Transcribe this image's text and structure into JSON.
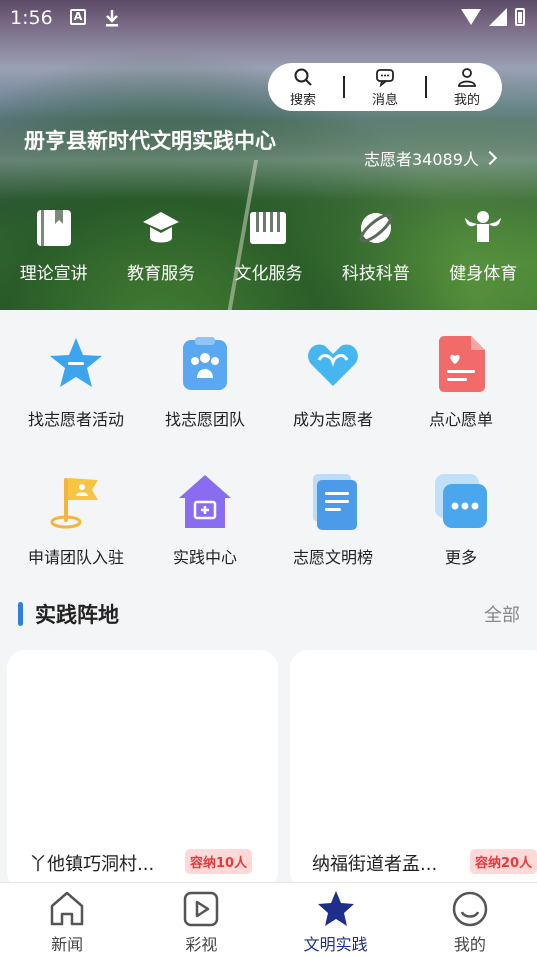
{
  "status_bar": {
    "time": "1:56",
    "a_icon": "A"
  },
  "toolbox": {
    "search": "搜索",
    "messages": "消息",
    "mine": "我的"
  },
  "center": {
    "title": "册亨县新时代文明实践中心",
    "volunteer_count": "志愿者34089人"
  },
  "hero_categories": [
    {
      "label": "理论宣讲",
      "icon": "book-icon"
    },
    {
      "label": "教育服务",
      "icon": "graduation-cap-icon"
    },
    {
      "label": "文化服务",
      "icon": "piano-icon"
    },
    {
      "label": "科技科普",
      "icon": "planet-icon"
    },
    {
      "label": "健身体育",
      "icon": "muscle-icon"
    }
  ],
  "services": [
    {
      "label": "找志愿者活动",
      "icon": "star-icon"
    },
    {
      "label": "找志愿团队",
      "icon": "team-clipboard-icon"
    },
    {
      "label": "成为志愿者",
      "icon": "heart-icon"
    },
    {
      "label": "点心愿单",
      "icon": "wish-document-icon"
    },
    {
      "label": "申请团队入驻",
      "icon": "flag-icon"
    },
    {
      "label": "实践中心",
      "icon": "house-icon"
    },
    {
      "label": "志愿文明榜",
      "icon": "list-document-icon"
    },
    {
      "label": "更多",
      "icon": "more-icon"
    }
  ],
  "section": {
    "title": "实践阵地",
    "all": "全部"
  },
  "cards": [
    {
      "name": "丫他镇巧洞村...",
      "badge": "容纳10人"
    },
    {
      "name": "纳福街道者孟...",
      "badge": "容纳20人"
    }
  ],
  "bottom_nav": [
    {
      "label": "新闻",
      "icon": "home-icon"
    },
    {
      "label": "彩视",
      "icon": "play-icon"
    },
    {
      "label": "文明实践",
      "icon": "star-icon",
      "active": true
    },
    {
      "label": "我的",
      "icon": "profile-icon"
    }
  ],
  "colors": {
    "accent": "#2f7fe0",
    "nav_active": "#1d2f8a",
    "badge_bg": "#ffd8d8",
    "badge_text": "#e83a3a"
  }
}
